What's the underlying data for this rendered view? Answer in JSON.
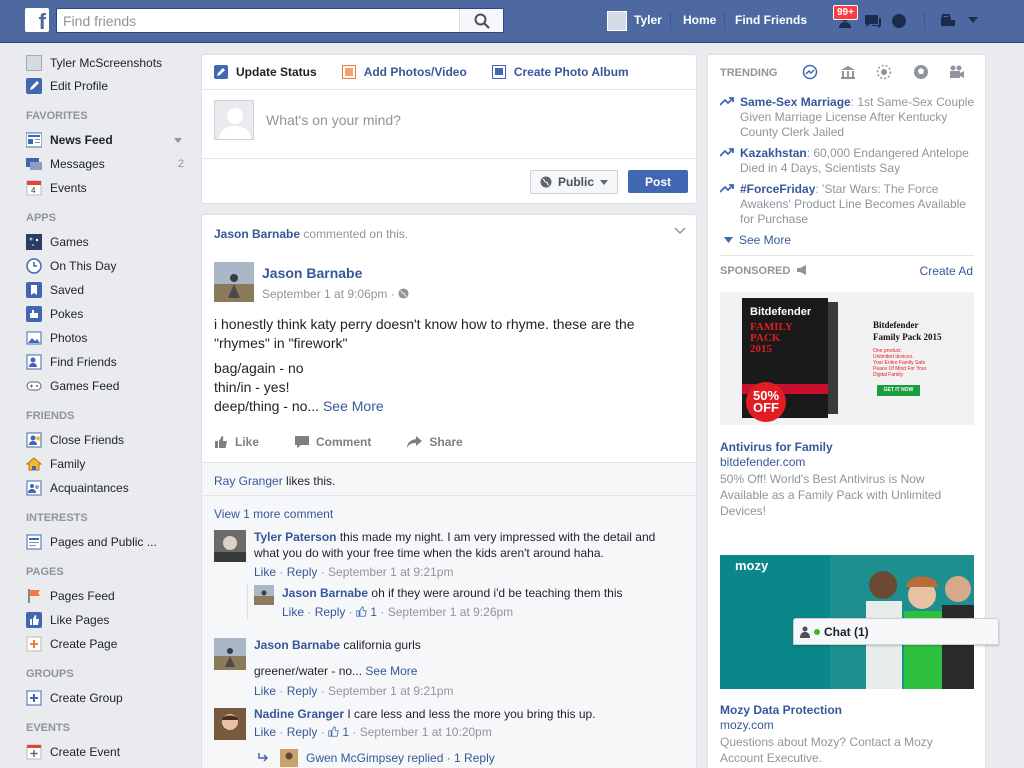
{
  "topbar": {
    "logo": "f",
    "search_placeholder": "Find friends",
    "user_name": "Tyler",
    "home": "Home",
    "find_friends": "Find Friends",
    "notif_count": "99+"
  },
  "left_nav": {
    "profile": "Tyler McScreenshots",
    "edit_profile": "Edit Profile",
    "favorites_header": "FAVORITES",
    "news_feed": "News Feed",
    "messages": "Messages",
    "messages_count": "2",
    "events": "Events",
    "apps_header": "APPS",
    "games": "Games",
    "on_this_day": "On This Day",
    "saved": "Saved",
    "pokes": "Pokes",
    "photos": "Photos",
    "find_friends": "Find Friends",
    "games_feed": "Games Feed",
    "friends_header": "FRIENDS",
    "close_friends": "Close Friends",
    "family": "Family",
    "acquaintances": "Acquaintances",
    "interests_header": "INTERESTS",
    "pages_public": "Pages and Public ...",
    "pages_header": "PAGES",
    "pages_feed": "Pages Feed",
    "like_pages": "Like Pages",
    "create_page": "Create Page",
    "groups_header": "GROUPS",
    "create_group": "Create Group",
    "events_header": "EVENTS",
    "create_event": "Create Event"
  },
  "composer": {
    "update_status": "Update Status",
    "add_photos": "Add Photos/Video",
    "create_album": "Create Photo Album",
    "placeholder": "What's on your mind?",
    "privacy": "Public",
    "post": "Post"
  },
  "story": {
    "actor": "Jason Barnabe",
    "action": "commented on this.",
    "author": "Jason Barnabe",
    "time": "September 1 at 9:06pm",
    "line1": "i honestly think katy perry doesn't know how to rhyme. these are the \"rhymes\" in \"firework\"",
    "line2": "bag/again - no",
    "line3": "thin/in - yes!",
    "line4": "deep/thing - no...",
    "see_more": "See More",
    "like": "Like",
    "comment": "Comment",
    "share": "Share",
    "likes_name": "Ray Granger",
    "likes_text": "likes this.",
    "view_more": "View 1 more comment",
    "comments": [
      {
        "name": "Tyler Paterson",
        "text": "this made my night. I am very impressed with the detail and what you do with your free time when the kids aren't around haha.",
        "like": "Like",
        "reply": "Reply",
        "time": "September 1 at 9:21pm"
      },
      {
        "name": "Jason Barnabe",
        "text": "oh if they were around i'd be teaching them this",
        "like": "Like",
        "reply": "Reply",
        "likes": "1",
        "time": "September 1 at 9:26pm"
      },
      {
        "name": "Jason Barnabe",
        "text": "california gurls",
        "text2": "greener/water - no...",
        "see_more": "See More",
        "like": "Like",
        "reply": "Reply",
        "time": "September 1 at 9:21pm"
      },
      {
        "name": "Nadine Granger",
        "text": "I care less and less the more you bring this up.",
        "like": "Like",
        "reply": "Reply",
        "likes": "1",
        "time": "September 1 at 10:20pm"
      }
    ],
    "replied_text": "Gwen McGimpsey replied · 1 Reply"
  },
  "trending": {
    "title": "TRENDING",
    "items": [
      {
        "topic": "Same-Sex Marriage",
        "desc": ": 1st Same-Sex Couple Given Marriage License After Kentucky County Clerk Jailed"
      },
      {
        "topic": "Kazakhstan",
        "desc": ": 60,000 Endangered Antelope Died in 4 Days, Scientists Say"
      },
      {
        "topic": "#ForceFriday",
        "desc": ": 'Star Wars: The Force Awakens' Product Line Becomes Available for Purchase"
      }
    ],
    "see_more": "See More"
  },
  "sponsored": {
    "label": "SPONSORED",
    "create_ad": "Create Ad",
    "ads": [
      {
        "title": "Antivirus for Family",
        "domain": "bitdefender.com",
        "desc": "50% Off! World's Best Antivirus is Now Available as a Family Pack with Unlimited Devices!",
        "brand": "Bitdefender",
        "product": "Family Pack 2015",
        "box": "FAMILY PACK 2015",
        "sale": "50% OFF",
        "tag1": "One product.",
        "tag2": "Unlimited devices.",
        "tag3": "Your Entire Family Safe",
        "tag4": "Peace Of Mind For Your",
        "tag5": "Digital Family",
        "cta": "GET IT NOW"
      },
      {
        "title": "Mozy Data Protection",
        "domain": "mozy.com",
        "desc": "Questions about Mozy? Contact a Mozy Account Executive.",
        "logo": "mozy"
      }
    ]
  },
  "chat": {
    "label": "Chat (1)"
  }
}
